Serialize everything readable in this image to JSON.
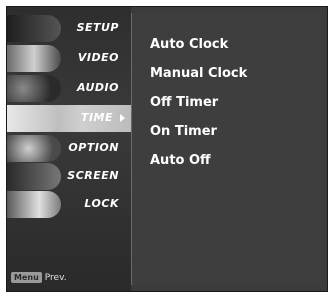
{
  "sidebar": {
    "items": [
      {
        "label": "SETUP"
      },
      {
        "label": "VIDEO"
      },
      {
        "label": "AUDIO"
      },
      {
        "label": "TIME"
      },
      {
        "label": "OPTION"
      },
      {
        "label": "SCREEN"
      },
      {
        "label": "LOCK"
      }
    ],
    "active_index": 3
  },
  "submenu": {
    "items": [
      {
        "label": "Auto Clock"
      },
      {
        "label": "Manual Clock"
      },
      {
        "label": "Off Timer"
      },
      {
        "label": "On Timer"
      },
      {
        "label": "Auto Off"
      }
    ]
  },
  "footer": {
    "key_label": "Menu",
    "action_label": "Prev."
  },
  "colors": {
    "background": "#3b3b3b",
    "active_highlight": "#cfcfcf",
    "text": "#ffffff"
  }
}
